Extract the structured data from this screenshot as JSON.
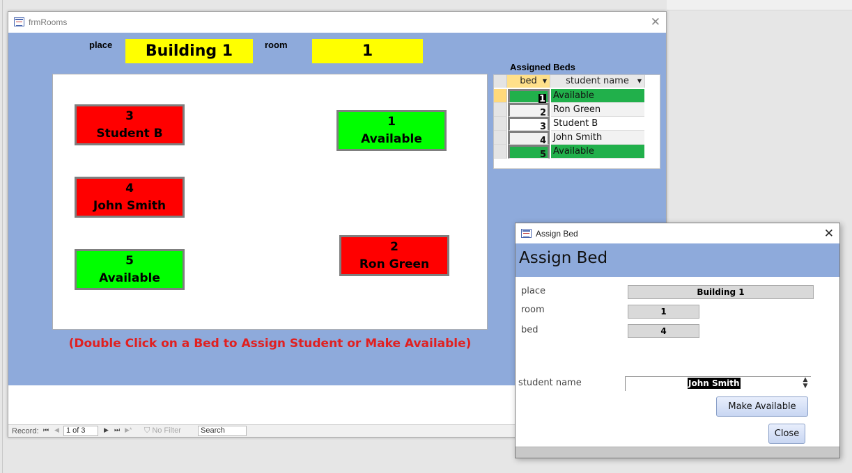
{
  "main_window": {
    "title": "frmRooms",
    "close_glyph": "✕",
    "place_label": "place",
    "place_value": "Building 1",
    "room_label": "room",
    "room_value": "1",
    "beds": [
      {
        "number": "3",
        "occupant": "Student B",
        "status": "occupied"
      },
      {
        "number": "1",
        "occupant": "Available",
        "status": "available"
      },
      {
        "number": "4",
        "occupant": "John Smith",
        "status": "occupied"
      },
      {
        "number": "5",
        "occupant": "Available",
        "status": "available"
      },
      {
        "number": "2",
        "occupant": "Ron Green",
        "status": "occupied"
      }
    ],
    "hint": "(Double Click on a Bed to Assign Student or Make Available)",
    "assigned_beds": {
      "title": "Assigned Beds",
      "columns": [
        "bed",
        "student name"
      ],
      "rows": [
        {
          "bed": "1",
          "name": "Available"
        },
        {
          "bed": "2",
          "name": "Ron Green"
        },
        {
          "bed": "3",
          "name": "Student B"
        },
        {
          "bed": "4",
          "name": "John Smith"
        },
        {
          "bed": "5",
          "name": "Available"
        }
      ]
    },
    "record_nav": {
      "label": "Record:",
      "current": "1 of 3",
      "filter": "No Filter",
      "search_placeholder": "Search"
    }
  },
  "dialog": {
    "title": "Assign Bed",
    "close_glyph": "✕",
    "heading": "Assign Bed",
    "place_label": "place",
    "place_value": "Building 1",
    "room_label": "room",
    "room_value": "1",
    "bed_label": "bed",
    "bed_value": "4",
    "student_label": "student name",
    "student_value": "John Smith",
    "make_available_label": "Make Available",
    "close_label": "Close"
  },
  "colors": {
    "form_background": "#8eaadb",
    "header_highlight": "#ffff00",
    "occupied": "#ff0000",
    "available": "#00ff00",
    "grid_available": "#21b04b",
    "hint_text": "#e02020"
  }
}
